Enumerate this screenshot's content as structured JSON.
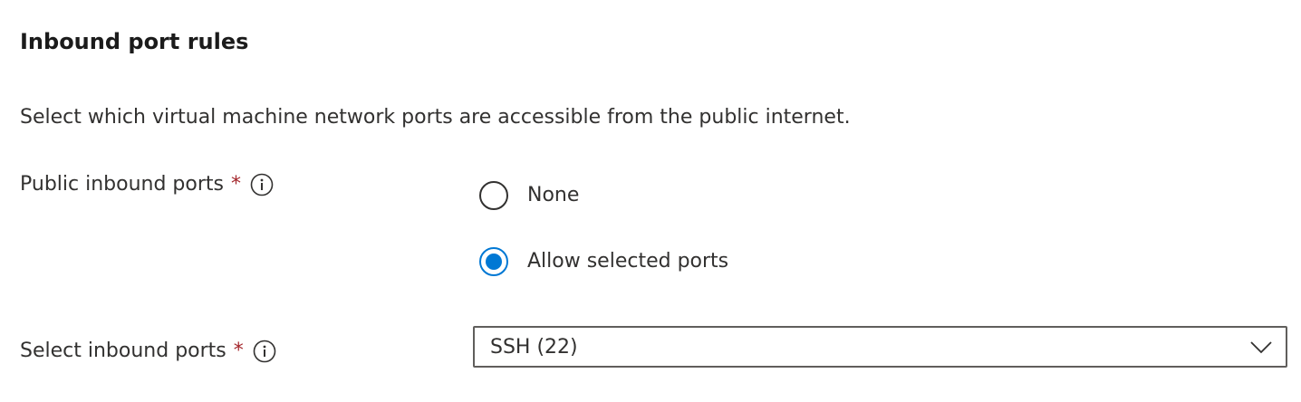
{
  "section": {
    "title": "Inbound port rules",
    "description": "Select which virtual machine network ports are accessible from the public internet."
  },
  "public_inbound_ports": {
    "label": "Public inbound ports",
    "required_marker": "*",
    "info_icon": "info-icon",
    "options": [
      {
        "label": "None",
        "selected": false
      },
      {
        "label": "Allow selected ports",
        "selected": true
      }
    ]
  },
  "select_inbound_ports": {
    "label": "Select inbound ports",
    "required_marker": "*",
    "info_icon": "info-icon",
    "value": "SSH (22)",
    "chevron_icon": "chevron-down-icon"
  },
  "colors": {
    "accent": "#0078d4",
    "required": "#a4262c",
    "text": "#323130"
  }
}
